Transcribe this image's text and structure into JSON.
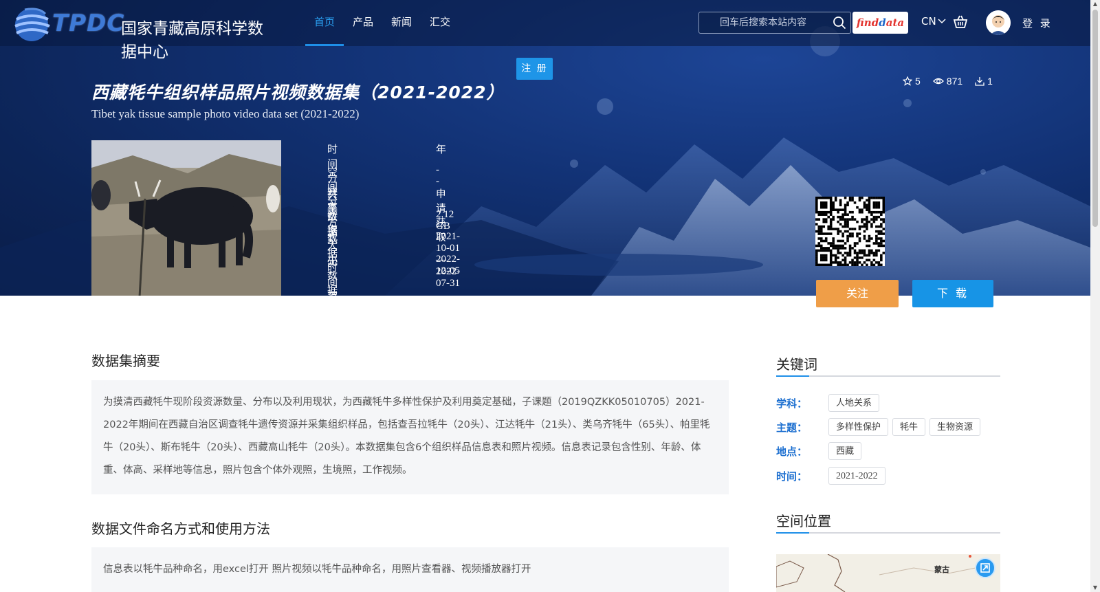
{
  "header": {
    "logo_text": "TPDC",
    "logo_cn": "国家青藏高原科学数据中心",
    "nav": [
      {
        "label": "首页",
        "active": true
      },
      {
        "label": "产品",
        "active": false
      },
      {
        "label": "新闻",
        "active": false
      },
      {
        "label": "汇交",
        "active": false
      }
    ],
    "search_placeholder": "回车后搜索本站内容",
    "findata_label_1": "find",
    "findata_label_2": "ata",
    "lang": "CN",
    "login": "登 录",
    "register": "注 册"
  },
  "dataset": {
    "title_cn": "西藏牦牛组织样品照片视频数据集（2021-2022）",
    "title_en": "Tibet yak tissue sample photo video data set (2021-2022)",
    "stats": {
      "stars": "5",
      "views": "871",
      "downloads": "1"
    },
    "meta": [
      {
        "key": "时间分辨率",
        "value": "年"
      },
      {
        "key": "空间分辨率",
        "value": "--"
      },
      {
        "key": "共享方式",
        "value": "申请获取"
      },
      {
        "key": "数据大小",
        "value": "2.12 GB"
      },
      {
        "key": "数据时间范围",
        "value": "2021-10-01 — 2022-07-31"
      },
      {
        "key": "元数据更新时间",
        "value": "2022-12-05"
      }
    ],
    "follow_label": "关注",
    "download_label": "下 载"
  },
  "abstract": {
    "heading": "数据集摘要",
    "text": "为摸清西藏牦牛现阶段资源数量、分布以及利用现状，为西藏牦牛多样性保护及利用奠定基础，子课题（2019QZKK05010705）2021-2022年期间在西藏自治区调查牦牛遗传资源并采集组织样品，包括查吾拉牦牛（20头）、江达牦牛（21头）、类乌齐牦牛（65头）、帕里牦牛（20头）、斯布牦牛（20头）、西藏高山牦牛（20头）。本数据集包含6个组织样品信息表和照片视频。信息表记录包含性别、年龄、体重、体高、采样地等信息，照片包含个体外观照，生境照，工作视频。"
  },
  "usage": {
    "heading": "数据文件命名方式和使用方法",
    "text": "信息表以牦牛品种命名，用excel打开 照片视频以牦牛品种命名，用照片查看器、视频播放器打开"
  },
  "keywords": {
    "heading": "关键词",
    "rows": [
      {
        "label": "学科：",
        "tags": [
          "人地关系"
        ]
      },
      {
        "label": "主题：",
        "tags": [
          "多样性保护",
          "牦牛",
          "生物资源"
        ]
      },
      {
        "label": "地点：",
        "tags": [
          "西藏"
        ]
      },
      {
        "label": "时间：",
        "tags": [
          "2021-2022"
        ]
      }
    ]
  },
  "location": {
    "heading": "空间位置",
    "map_label": "蒙古"
  },
  "colors": {
    "accent": "#1e8fe8",
    "follow": "#ef9e48",
    "keyword_label": "#1c6fd0",
    "hero_bg": "#123275"
  }
}
